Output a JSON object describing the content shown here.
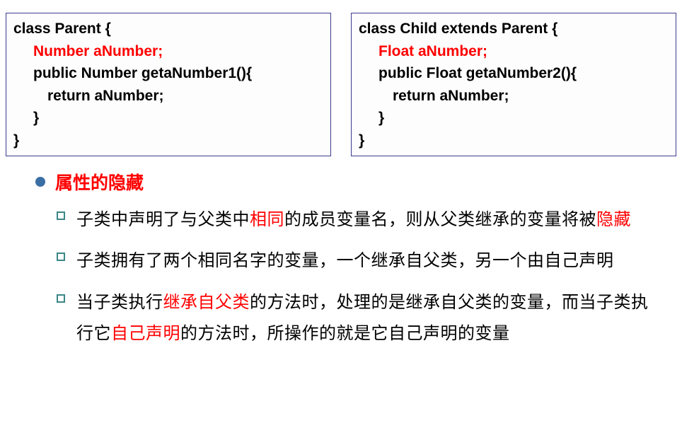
{
  "code": {
    "parent": {
      "l1": "class Parent {",
      "l2": "Number aNumber;",
      "l3": "public Number getaNumber1(){",
      "l4": "return aNumber;",
      "l5": "}",
      "l6": "}"
    },
    "child": {
      "l1": "class Child extends Parent {",
      "l2": "Float aNumber;",
      "l3": "public Float getaNumber2(){",
      "l4": "return aNumber;",
      "l5": "}",
      "l6": "}"
    }
  },
  "heading": "属性的隐藏",
  "items": {
    "i1": {
      "p1": "子类中声明了与父类中",
      "p2": "相同",
      "p3": "的成员变量名，则从父类继承的变量将被",
      "p4": "隐藏"
    },
    "i2": {
      "p1": "子类拥有了两个相同名字的变量，一个继承自父类，另一个由自己声明"
    },
    "i3": {
      "p1": "当子类执行",
      "p2": "继承自父类",
      "p3": "的方法时，处理的是继承自父类的变量，而当子类执行它",
      "p4": "自己声明",
      "p5": "的方法时，所操作的就是它自己声明的变量"
    }
  }
}
